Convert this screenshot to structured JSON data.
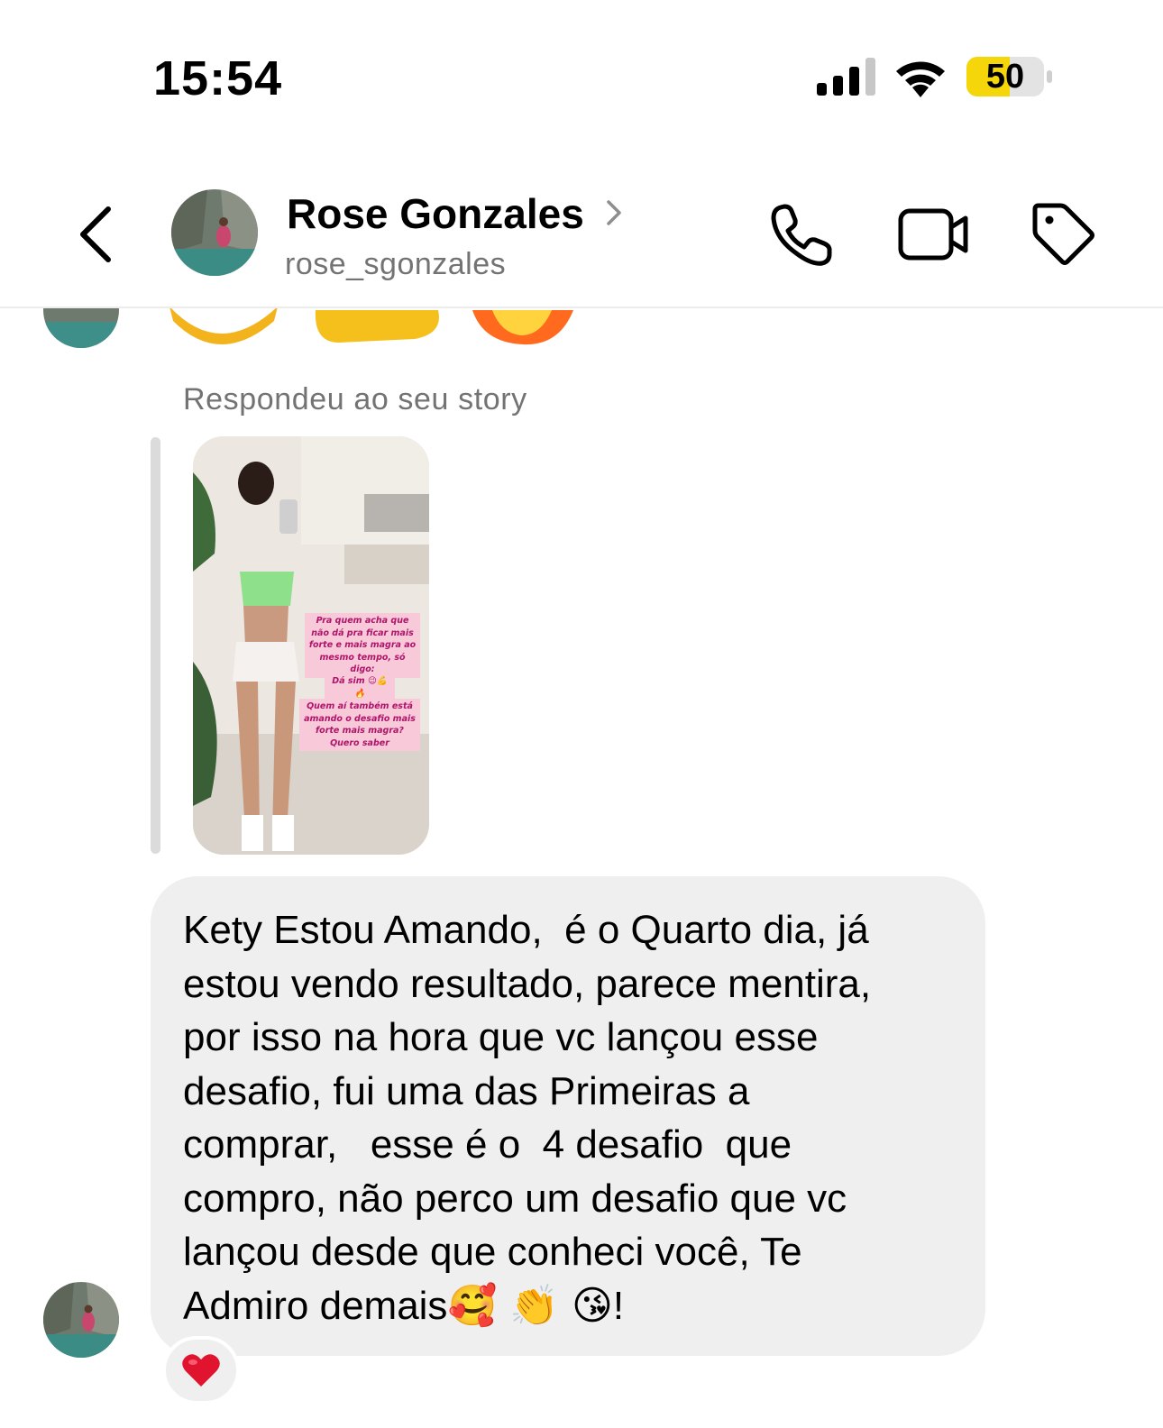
{
  "status_bar": {
    "time": "15:54",
    "battery_level": "50",
    "battery_color": "#f5d60a",
    "signal_icon": "signal-bars-icon",
    "wifi_icon": "wifi-icon"
  },
  "header": {
    "back_icon": "chevron-left-icon",
    "contact_name": "Rose Gonzales",
    "contact_username": "rose_sgonzales",
    "name_chevron_icon": "chevron-right-icon",
    "actions": [
      {
        "name": "call-button",
        "icon": "phone-icon"
      },
      {
        "name": "video-call-button",
        "icon": "video-camera-icon"
      },
      {
        "name": "tag-button",
        "icon": "tag-icon"
      }
    ]
  },
  "story_reply": {
    "caption": "Respondeu ao seu story",
    "story_overlay_lines": [
      "Pra quem acha que não dá pra ficar mais forte e mais magra ao mesmo tempo, só digo:",
      "Dá sim 😉💪🔥",
      "Quem aí também está amando o desafio mais forte mais magra? Quero saber"
    ]
  },
  "message": {
    "text": "Kety Estou Amando,  é o Quarto dia, já\nestou vendo resultado, parece mentira,\npor isso na hora que vc lançou esse\ndesafio, fui uma das Primeiras a\ncomprar,   esse é o  4 desafio  que\ncompro, não perco um desafio que vc\nlançou desde que conheci você, Te\nAdmiro demais",
    "trailing_emojis": "🥰 👏 😘",
    "trailing_punctuation": "!",
    "reaction": "❤️",
    "bubble_color": "#efefef"
  }
}
